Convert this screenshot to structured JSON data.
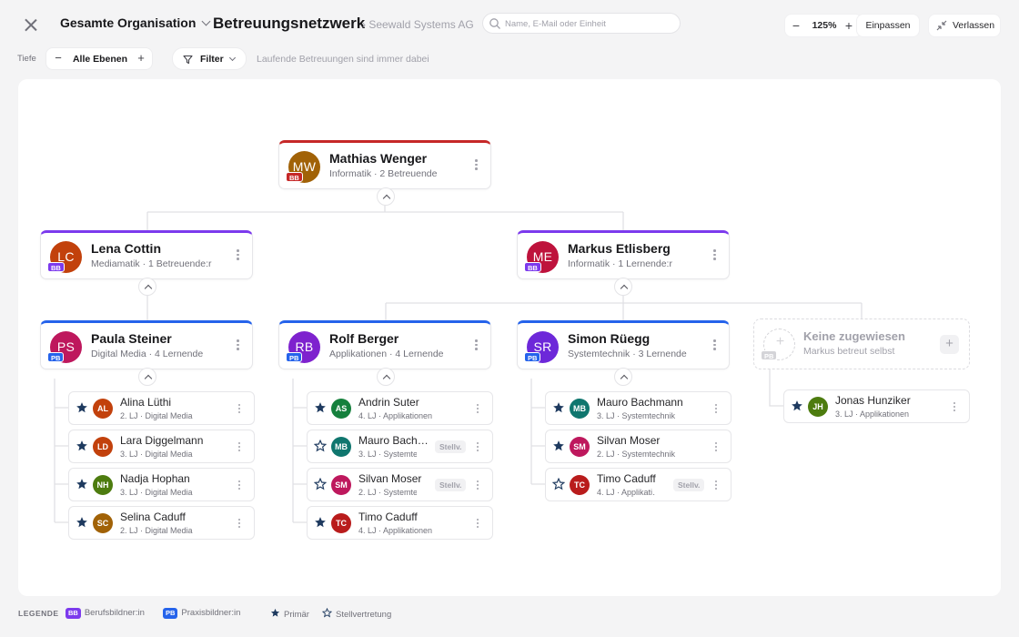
{
  "header": {
    "org_select": "Gesamte Organisation",
    "title": "Betreuungsnetzwerk",
    "breadcrumb": "› Seewald Systems AG",
    "search_placeholder": "Name, E-Mail oder Einheit",
    "zoom_minus": "−",
    "zoom_level": "125%",
    "zoom_plus": "+",
    "fit_label": "Einpassen",
    "leave_label": "Verlassen"
  },
  "toolbar": {
    "depth_label": "Tiefe",
    "depth_minus": "−",
    "depth_value": "Alle Ebenen",
    "depth_plus": "+",
    "filter_label": "Filter",
    "filter_note": "Laufende Betreuungen sind immer dabei"
  },
  "colors": {
    "bb": "#7c3aed",
    "pb": "#2563eb",
    "root_accent": "#c62828",
    "star": "#1e3a5f"
  },
  "root": {
    "initials": "MW",
    "name": "Mathias Wenger",
    "sub": "Informatik · 2 Betreuende",
    "role": "BB",
    "avatar_color": "#a16207"
  },
  "level2": [
    {
      "initials": "LC",
      "name": "Lena Cottin",
      "sub": "Mediamatik · 1 Betreuende:r",
      "role": "BB",
      "avatar_color": "#c2410c"
    },
    {
      "initials": "ME",
      "name": "Markus Etlisberg",
      "sub": "Informatik · 1 Lernende:r",
      "role": "BB",
      "avatar_color": "#be123c"
    }
  ],
  "level3": [
    {
      "initials": "PS",
      "name": "Paula Steiner",
      "sub": "Digital Media · 4 Lernende",
      "role": "PB",
      "avatar_color": "#be185d"
    },
    {
      "initials": "RB",
      "name": "Rolf Berger",
      "sub": "Applikationen · 4 Lernende",
      "role": "PB",
      "avatar_color": "#7e22ce"
    },
    {
      "initials": "SR",
      "name": "Simon Rüegg",
      "sub": "Systemtechnik · 3 Lernende",
      "role": "PB",
      "avatar_color": "#6d28d9"
    }
  ],
  "unassigned": {
    "title": "Keine zugewiesen",
    "sub": "Markus betreut selbst",
    "role": "PB"
  },
  "learners": [
    [
      {
        "initials": "AL",
        "name": "Alina Lüthi",
        "sub": "2. LJ · Digital Media",
        "primary": true,
        "tag": "",
        "avatar_color": "#c2410c"
      },
      {
        "initials": "LD",
        "name": "Lara Diggelmann",
        "sub": "3. LJ · Digital Media",
        "primary": true,
        "tag": "",
        "avatar_color": "#c2410c"
      },
      {
        "initials": "NH",
        "name": "Nadja Hophan",
        "sub": "3. LJ · Digital Media",
        "primary": true,
        "tag": "",
        "avatar_color": "#4d7c0f"
      },
      {
        "initials": "SC",
        "name": "Selina Caduff",
        "sub": "2. LJ · Digital Media",
        "primary": true,
        "tag": "",
        "avatar_color": "#a16207"
      }
    ],
    [
      {
        "initials": "AS",
        "name": "Andrin Suter",
        "sub": "4. LJ · Applikationen",
        "primary": true,
        "tag": "",
        "avatar_color": "#15803d"
      },
      {
        "initials": "MB",
        "name": "Mauro Bach…",
        "sub": "3. LJ · Systemte…",
        "primary": false,
        "tag": "Stellv.",
        "avatar_color": "#0f766e"
      },
      {
        "initials": "SM",
        "name": "Silvan Moser",
        "sub": "2. LJ · Systemte…",
        "primary": false,
        "tag": "Stellv.",
        "avatar_color": "#be185d"
      },
      {
        "initials": "TC",
        "name": "Timo Caduff",
        "sub": "4. LJ · Applikationen",
        "primary": true,
        "tag": "",
        "avatar_color": "#b91c1c"
      }
    ],
    [
      {
        "initials": "MB",
        "name": "Mauro Bachmann",
        "sub": "3. LJ · Systemtechnik",
        "primary": true,
        "tag": "",
        "avatar_color": "#0f766e"
      },
      {
        "initials": "SM",
        "name": "Silvan Moser",
        "sub": "2. LJ · Systemtechnik",
        "primary": true,
        "tag": "",
        "avatar_color": "#be185d"
      },
      {
        "initials": "TC",
        "name": "Timo Caduff",
        "sub": "4. LJ · Applikati…",
        "primary": false,
        "tag": "Stellv.",
        "avatar_color": "#b91c1c"
      }
    ],
    [
      {
        "initials": "JH",
        "name": "Jonas Hunziker",
        "sub": "3. LJ · Applikationen",
        "primary": true,
        "tag": "",
        "avatar_color": "#4d7c0f"
      }
    ]
  ],
  "legend": {
    "title": "LEGENDE",
    "bb_badge": "BB",
    "bb_label": "Berufsbildner:in",
    "pb_badge": "PB",
    "pb_label": "Praxisbildner:in",
    "primary_label": "Primär",
    "substitute_label": "Stellvertretung"
  }
}
